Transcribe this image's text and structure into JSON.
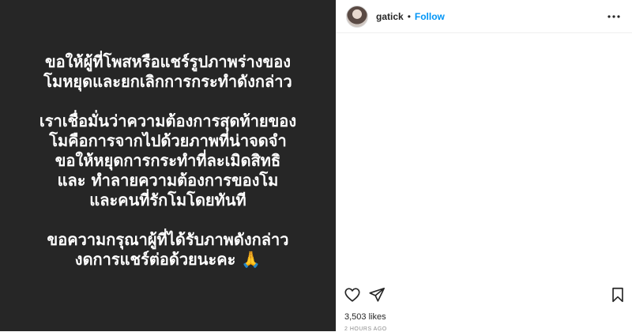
{
  "post": {
    "image_text": {
      "para1": [
        "ขอให้ผู้ที่โพสหรือแชร์รูปภาพร่างของ",
        "โมหยุดและยกเลิกการกระทำดังกล่าว"
      ],
      "para2": [
        "เราเชื่อมั่นว่าความต้องการสุดท้ายของ",
        "โมคือการจากไปด้วยภาพที่น่าจดจำ",
        "ขอให้หยุดการกระทำที่ละเมิดสิทธิ",
        "และ  ทำลายความต้องการของโม",
        "และคนที่รักโมโดยทันที"
      ],
      "para3": [
        "ขอความกรุณาผู้ที่ได้รับภาพดังกล่าว",
        "งดการแชร์ต่อด้วยนะคะ 🙏"
      ]
    }
  },
  "header": {
    "username": "gatick",
    "separator": "•",
    "follow_label": "Follow"
  },
  "icons": {
    "more": "more-options-icon",
    "like": "heart-icon",
    "share": "paper-plane-icon",
    "save": "bookmark-icon"
  },
  "stats": {
    "likes": "3,503 likes",
    "timestamp": "2 HOURS AGO"
  },
  "colors": {
    "image_bg": "#262626",
    "follow": "#0095f6",
    "text": "#262626",
    "muted": "#8e8e8e"
  }
}
